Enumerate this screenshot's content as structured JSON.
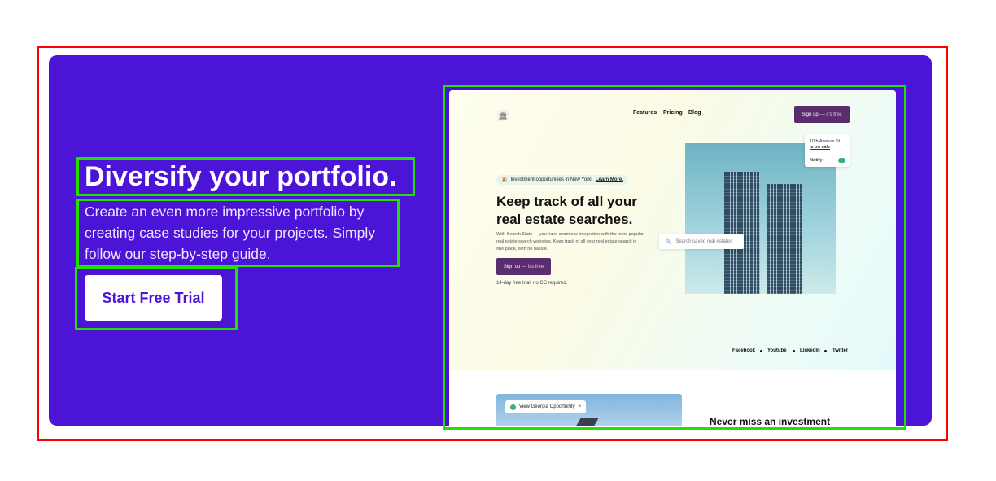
{
  "hero": {
    "title": "Diversify your portfolio.",
    "subtitle": "Create an even more impressive portfolio by creating case studies for your projects. Simply follow our step-by-step guide.",
    "cta_label": "Start Free Trial"
  },
  "preview": {
    "nav": {
      "features": "Features",
      "pricing": "Pricing",
      "blog": "Blog"
    },
    "signup": {
      "label": "Sign up",
      "suffix": "— it's free"
    },
    "badge": {
      "text": "Investment opportunities in New York!",
      "link": "Learn More."
    },
    "headline": "Keep track of all your real estate searches.",
    "body": "With Search State — you have seamless integration with the most popular real estate search websites. Keep track of all your real estate search in one place, with no hassle.",
    "trial_note": "14-day free trial, no CC required.",
    "notify_card": {
      "address": "10th Avenue St.",
      "status": "is on sale",
      "label": "Notify"
    },
    "search_placeholder": "Search saved real estates",
    "socials": [
      "Facebook",
      "Youtube",
      "LinkedIn",
      "Twitter"
    ],
    "opportunity_tag": "View Georgia Opportunity",
    "section_heading": "Never miss an investment"
  },
  "colors": {
    "brand": "#4c14d6",
    "preview_button": "#5a2d6e",
    "accent_green": "#3ab07d"
  }
}
